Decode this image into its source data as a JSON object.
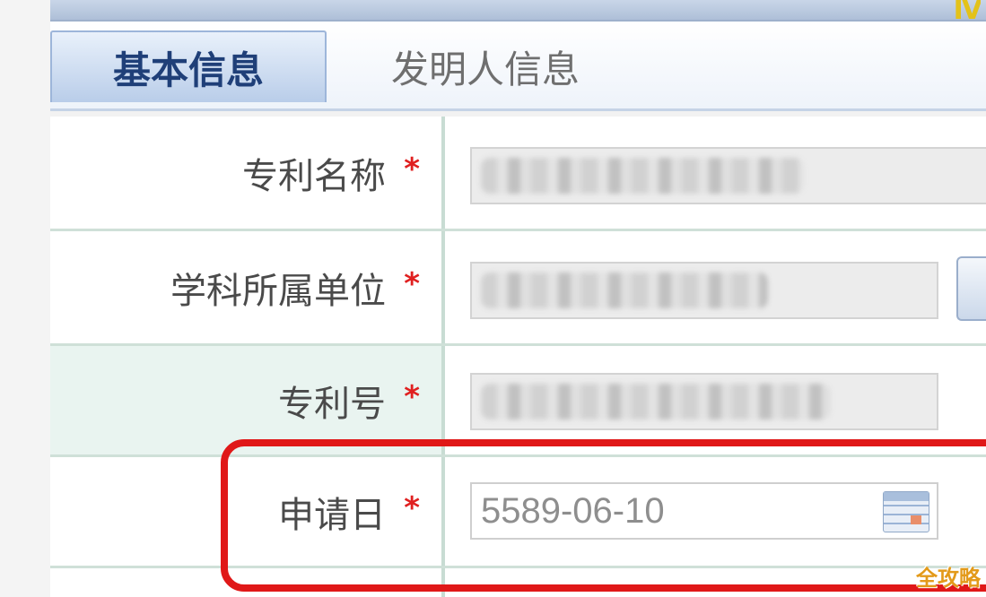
{
  "header": {
    "logo_text": "IV"
  },
  "tabs": [
    {
      "label": "基本信息",
      "active": true
    },
    {
      "label": "发明人信息",
      "active": false
    }
  ],
  "form": {
    "rows": [
      {
        "label": "专利名称",
        "required_mark": "*",
        "value": ""
      },
      {
        "label": "学科所属单位",
        "required_mark": "*",
        "value": ""
      },
      {
        "label": "专利号",
        "required_mark": "*",
        "value": ""
      },
      {
        "label": "申请日",
        "required_mark": "*",
        "value": "5589-06-10"
      }
    ]
  },
  "watermark": "全攻略",
  "colors": {
    "highlight_frame": "#e01818",
    "required_star": "#e02020",
    "active_tab_text": "#1f3f78"
  }
}
